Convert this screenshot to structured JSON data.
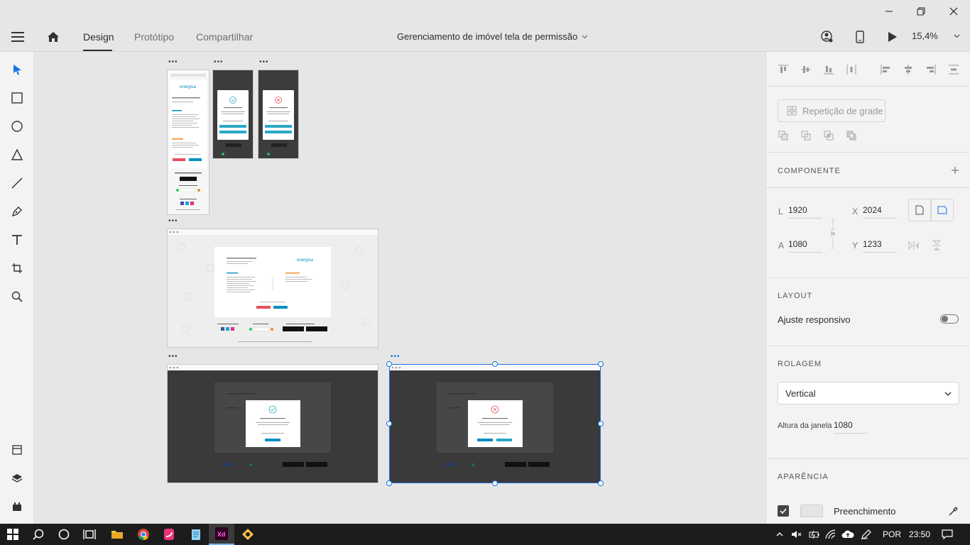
{
  "window": {
    "minimize_icon": "minimize-icon",
    "restore_icon": "restore-icon",
    "close_icon": "close-icon"
  },
  "header": {
    "tabs": [
      {
        "label": "Design",
        "active": true
      },
      {
        "label": "Protótipo",
        "active": false
      },
      {
        "label": "Compartilhar",
        "active": false
      }
    ],
    "document_title": "Gerenciamento de imóvel tela de permissão",
    "zoom": "15,4%"
  },
  "artboard_menu": "•••",
  "artboards": {
    "mobile_brand": "energisa",
    "desktop_brand": "energisa"
  },
  "panel": {
    "repeat_grid_label": "Repetição de grade",
    "component_title": "COMPONENTE",
    "transform": {
      "width_label": "L",
      "width": "1920",
      "x_label": "X",
      "x": "2024",
      "height_label": "A",
      "height": "1080",
      "y_label": "Y",
      "y": "1233"
    },
    "layout_title": "LAYOUT",
    "responsive_label": "Ajuste responsivo",
    "responsive_on": false,
    "scroll_title": "ROLAGEM",
    "scroll_value": "Vertical",
    "viewport_label": "Altura da janela",
    "viewport_value": "1080",
    "appearance_title": "APARÊNCIA",
    "fill_label": "Preenchimento",
    "fill_color": "#e4e4e4"
  },
  "taskbar": {
    "language": "POR",
    "time": "23:50"
  },
  "colors": {
    "accent": "#1473e6",
    "energisa_blue": "#0a8fc4",
    "energisa_orange": "#f08a24",
    "success": "#2aa8c8",
    "danger": "#e8505b"
  }
}
